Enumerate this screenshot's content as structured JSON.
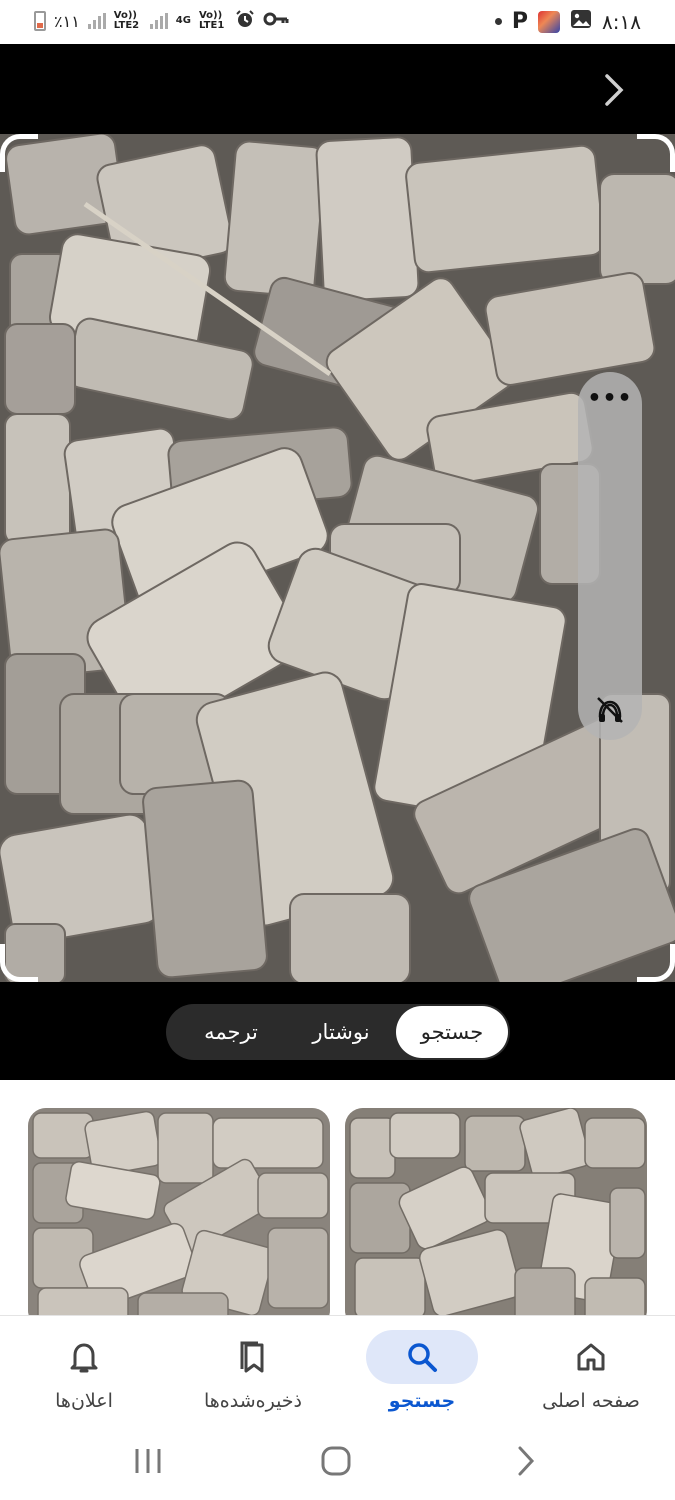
{
  "status_bar": {
    "battery_text": "٪۱۱",
    "net1": "Vo)) LTE2",
    "net2_type": "4G",
    "net2": "Vo)) LTE1",
    "time": "۸:۱۸",
    "p_badge": "P",
    "icons": [
      "battery-icon",
      "signal-icon",
      "alarm-icon",
      "key-icon",
      "dot-icon",
      "pinterest-icon",
      "app-icon",
      "gallery-icon"
    ]
  },
  "viewer": {
    "next_icon": "chevron-right-icon",
    "more_label": "•••",
    "mute_icon": "mute-off-icon"
  },
  "lens_modes": {
    "active": "جستجو",
    "items": [
      "جستجو",
      "نوشتار",
      "ترجمه"
    ]
  },
  "results": {
    "thumbnails": [
      "bricks-result-1",
      "bricks-result-2"
    ]
  },
  "bottom_nav": {
    "items": [
      {
        "label": "صفحه اصلی",
        "icon": "home-icon"
      },
      {
        "label": "جستجو",
        "icon": "search-icon"
      },
      {
        "label": "ذخیره‌شده‌ها",
        "icon": "bookmarks-icon"
      },
      {
        "label": "اعلان‌ها",
        "icon": "bell-icon"
      }
    ],
    "active": "جستجو"
  },
  "system_nav": {
    "icons": [
      "recents-icon",
      "home-circle-icon",
      "back-icon"
    ]
  },
  "colors": {
    "accent": "#0b57d0",
    "active_pill": "#dfe7f9",
    "segment_bg": "#2b2b2b"
  }
}
